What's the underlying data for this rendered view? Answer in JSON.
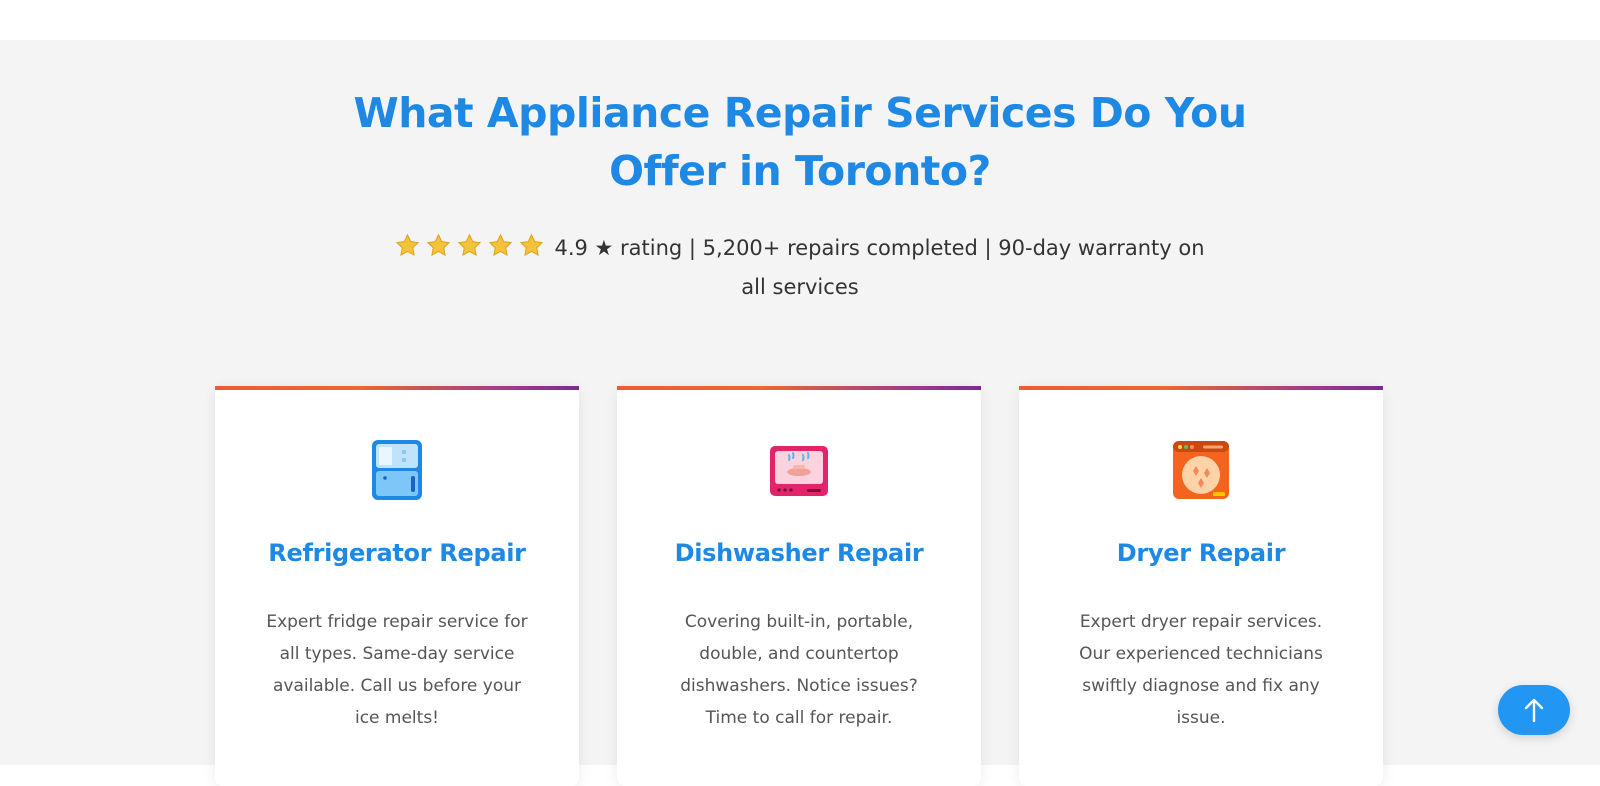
{
  "section": {
    "headline": "What Appliance Repair Services Do You Offer in Toronto?",
    "rating_text": "4.9 ★ rating | 5,200+ repairs completed | 90-day warranty on all services",
    "star_count": 5,
    "colors": {
      "heading": "#1e88e5",
      "background": "#f4f4f4",
      "star": "#f5c33b",
      "accent_gradient": [
        "#ef5a3a",
        "#7b2a93"
      ]
    }
  },
  "cards": [
    {
      "icon": "refrigerator-icon",
      "title": "Refrigerator Repair",
      "description": "Expert fridge repair service for all types. Same-day service available. Call us before your ice melts!"
    },
    {
      "icon": "dishwasher-icon",
      "title": "Dishwasher Repair",
      "description": "Covering built-in, portable, double, and countertop dishwashers. Notice issues? Time to call for repair."
    },
    {
      "icon": "dryer-icon",
      "title": "Dryer Repair",
      "description": "Expert dryer repair services. Our experienced technicians swiftly diagnose and fix any issue."
    }
  ],
  "scroll_top": {
    "icon": "arrow-up-icon",
    "color": "#2196f3"
  }
}
